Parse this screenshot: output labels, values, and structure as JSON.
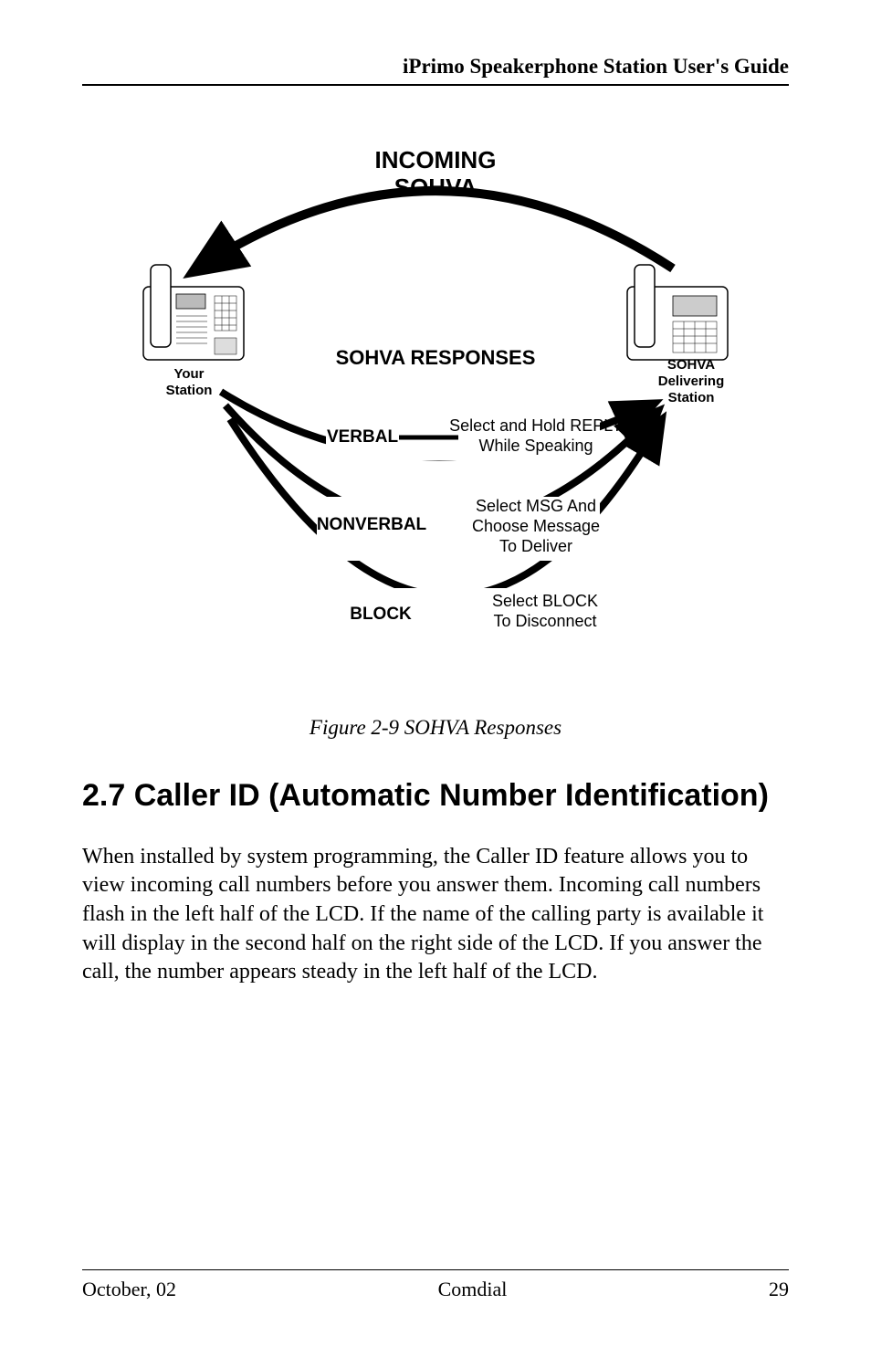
{
  "header": {
    "title": "iPrimo Speakerphone Station User's Guide"
  },
  "figure": {
    "top_label_l1": "INCOMING",
    "top_label_l2": "SOHVA",
    "mid_label": "SOHVA RESPONSES",
    "left_station_l1": "Your",
    "left_station_l2": "Station",
    "right_station_l1": "SOHVA",
    "right_station_l2": "Delivering",
    "right_station_l3": "Station",
    "verbal_label": "VERBAL",
    "verbal_desc_l1": "Select and Hold REPLY",
    "verbal_desc_l2": "While Speaking",
    "nonverbal_label": "NONVERBAL",
    "nonverbal_desc_l1": "Select MSG And",
    "nonverbal_desc_l2": "Choose Message",
    "nonverbal_desc_l3": "To Deliver",
    "block_label": "BLOCK",
    "block_desc_l1": "Select BLOCK",
    "block_desc_l2": "To Disconnect",
    "caption": "Figure 2-9  SOHVA Responses"
  },
  "section": {
    "heading": "2.7  Caller ID (Automatic Number Identification)",
    "body": "When installed by system programming, the Caller ID feature allows you to view incoming call numbers before you answer them. Incoming call numbers flash in the left half of the LCD. If the name of the calling party is available it will display in the second half on the right side of the LCD. If you answer the call, the number appears steady in the left half of the LCD."
  },
  "footer": {
    "left": "October, 02",
    "center": "Comdial",
    "right": "29"
  }
}
